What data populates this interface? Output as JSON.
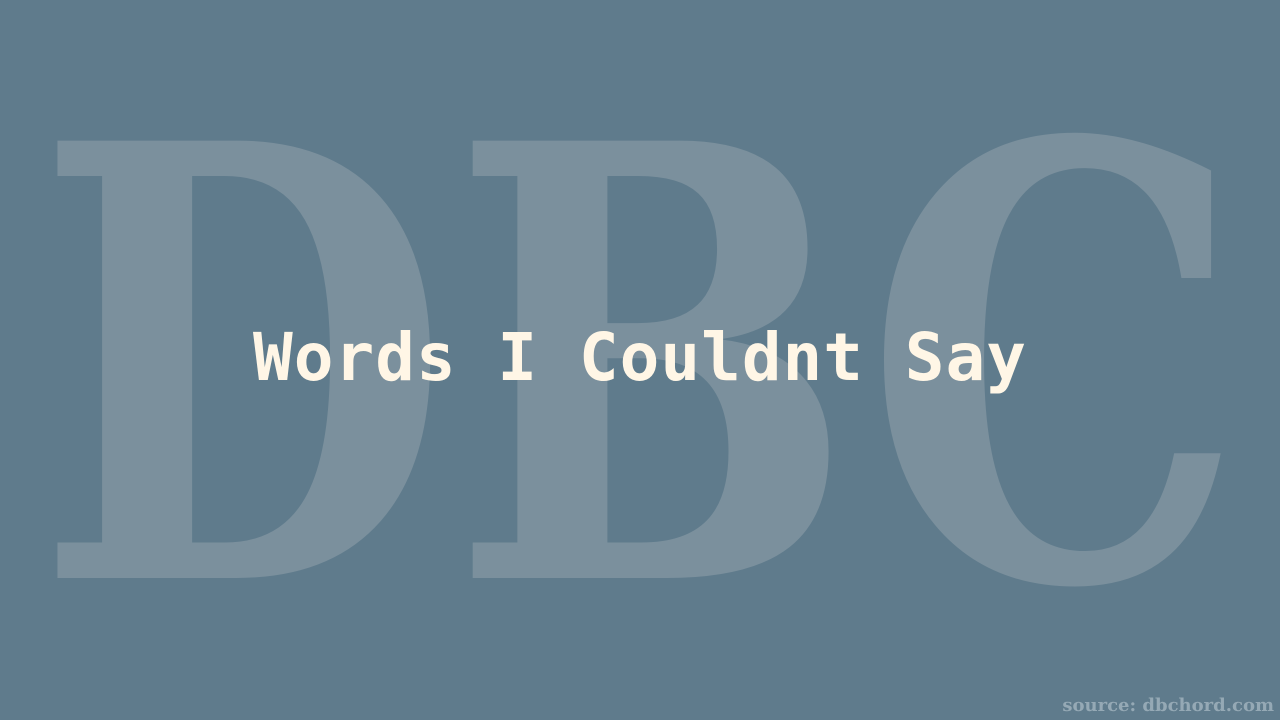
{
  "background_color": "#5f7b8c",
  "watermark": {
    "text": "DBC",
    "color": "#7b909d"
  },
  "title": "Words I Couldnt Say",
  "title_color": "#fff6e6",
  "source": "source: dbchord.com"
}
